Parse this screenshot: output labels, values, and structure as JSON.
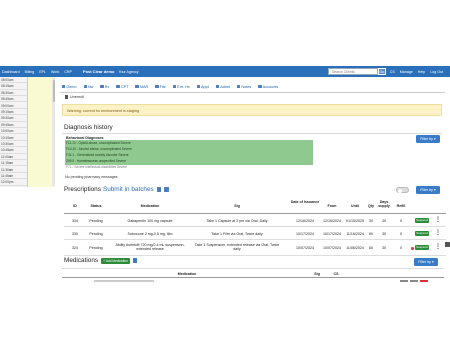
{
  "nav": {
    "items": [
      "Dashboard",
      "Billing",
      "EPL",
      "Work",
      "CRP",
      "Post Clear demo",
      "Your Agency"
    ],
    "search_placeholder": "Search Clients",
    "go_label": "Go",
    "right_items": [
      "CS",
      "Manage",
      "Help",
      "Log Out"
    ]
  },
  "sidebar": {
    "slots": [
      "08:00am",
      "08:15am",
      "08:30am",
      "08:45am",
      "09:00am",
      "09:15am",
      "09:30am",
      "09:45am",
      "10:00am",
      "10:15am",
      "10:30am",
      "10:45am",
      "11:00am",
      "11:15am",
      "11:30am",
      "11:45am",
      "12:00pm"
    ]
  },
  "toolbar": {
    "items": [
      "Demo",
      "Nw",
      "Rx",
      "CPT",
      "MAR",
      "File",
      "Enr. Hx",
      "Appt",
      "Admit",
      "Notes",
      "Accounts"
    ]
  },
  "unenroll_label": "Unenroll",
  "warning_text": "Warning: current hx environment is staging",
  "diagnosis": {
    "title": "Diagnosis history",
    "subtitle": "Behavioral Diagnoses",
    "lines": [
      "F11.10 - Opioid abuse, uncomplicated Severe",
      "F10.10 - Alcohol abuse, uncomplicated Severe",
      "F41.1 - Generalized anxiety disorder Severe",
      "Z59.0 - Homelessness unspecified Severe"
    ],
    "extra_line": "F71 - Severe intellectual disabilities Severe",
    "no_pending": "No pending pharmacy messages",
    "filter_label": "Filter by"
  },
  "prescriptions": {
    "title": "Prescriptions",
    "submit_label": "Submit in batches",
    "filter_label": "Filter by",
    "columns": [
      "ID",
      "Status",
      "Medication",
      "Sig",
      "Date of Issuance",
      "From",
      "Until",
      "Qty",
      "Days supply",
      "Refill"
    ],
    "rows": [
      {
        "id": "334",
        "status": "Pending",
        "medication": "Gabapentin 100 mg capsule",
        "sig": "Take 1 Capsule at 2 pm via Oral, Daily",
        "issued": "12/16/2024",
        "from": "12/16/2024",
        "until": "01/15/2025",
        "qty": "30",
        "days": "30",
        "refill": "0",
        "action": "Suspend"
      },
      {
        "id": "330",
        "status": "Pending",
        "medication": "Suboxone 2 mg-0.5 mg, film",
        "sig": "Take 1 Film via Oral, Twice daily",
        "issued": "10/17/2024",
        "from": "10/17/2024",
        "until": "11/16/2024",
        "qty": "60",
        "days": "30",
        "refill": "0",
        "action": "Suspend"
      },
      {
        "id": "324",
        "status": "Pending",
        "medication": "Abilify Asimtufii 720 mg/2.4 mL suspension, extended release",
        "sig": "Take 1 Suspension, extended release via Oral, Twice daily",
        "issued": "10/07/2024",
        "from": "10/07/2024",
        "until": "11/06/2024",
        "qty": "60",
        "days": "30",
        "refill": "0",
        "action": "Suspend"
      }
    ]
  },
  "medications": {
    "title": "Medications",
    "add_label": "Add Medication",
    "filter_label": "Filter by",
    "columns": [
      "Medication",
      "Sig",
      "CS"
    ]
  }
}
